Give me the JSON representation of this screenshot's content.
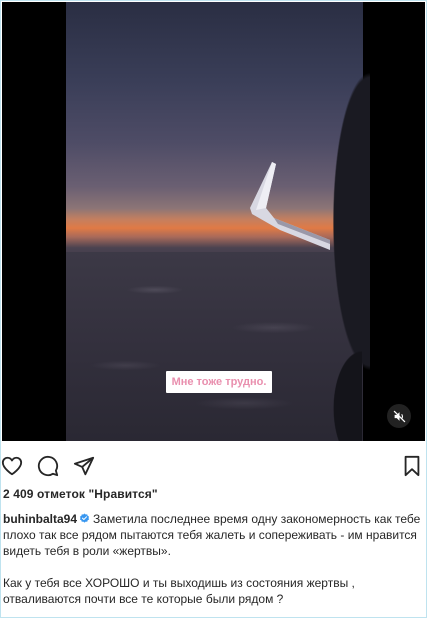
{
  "media": {
    "overlay_text": "Мне тоже трудно.",
    "mute_icon": "speaker-muted-icon"
  },
  "actions": {
    "like_icon": "heart-icon",
    "comment_icon": "comment-bubble-icon",
    "share_icon": "paper-plane-icon",
    "save_icon": "bookmark-icon"
  },
  "likes_text": "2 409 отметок \"Нравится\"",
  "caption": {
    "username": "buhinbalta94",
    "verified_icon": "verified-badge-icon",
    "text1": "Заметила последнее время одну закономерность как тебе плохо так все рядом пытаются тебя жалеть и сопереживать - им нравится видеть тебя в роли «жертвы».",
    "text2": "Как у тебя все ХОРОШО и ты выходишь из состояния жертвы , отваливаются почти все те которые были рядом ?"
  },
  "colors": {
    "overlay_text": "#e98fae",
    "verified": "#3897f0",
    "frame_border": "#bfe3ef"
  }
}
